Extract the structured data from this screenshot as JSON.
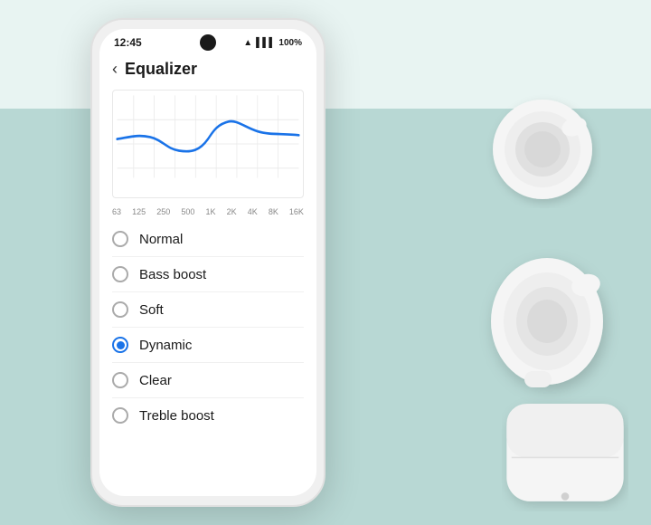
{
  "statusBar": {
    "time": "12:45",
    "wifi": "wifi",
    "signal": "signal",
    "battery": "100%"
  },
  "header": {
    "backLabel": "‹",
    "title": "Equalizer"
  },
  "chart": {
    "xLabels": [
      "63",
      "125",
      "250",
      "500",
      "1K",
      "2K",
      "4K",
      "8K",
      "16K"
    ]
  },
  "options": [
    {
      "id": "normal",
      "label": "Normal",
      "selected": false
    },
    {
      "id": "bass-boost",
      "label": "Bass boost",
      "selected": false
    },
    {
      "id": "soft",
      "label": "Soft",
      "selected": false
    },
    {
      "id": "dynamic",
      "label": "Dynamic",
      "selected": true
    },
    {
      "id": "clear",
      "label": "Clear",
      "selected": false
    },
    {
      "id": "treble-boost",
      "label": "Treble boost",
      "selected": false
    }
  ],
  "colors": {
    "accent": "#1a73e8",
    "background": "#b8d8d4",
    "topBg": "#e8f4f2",
    "phoneBg": "#f0f0f0",
    "screenBg": "#ffffff"
  }
}
